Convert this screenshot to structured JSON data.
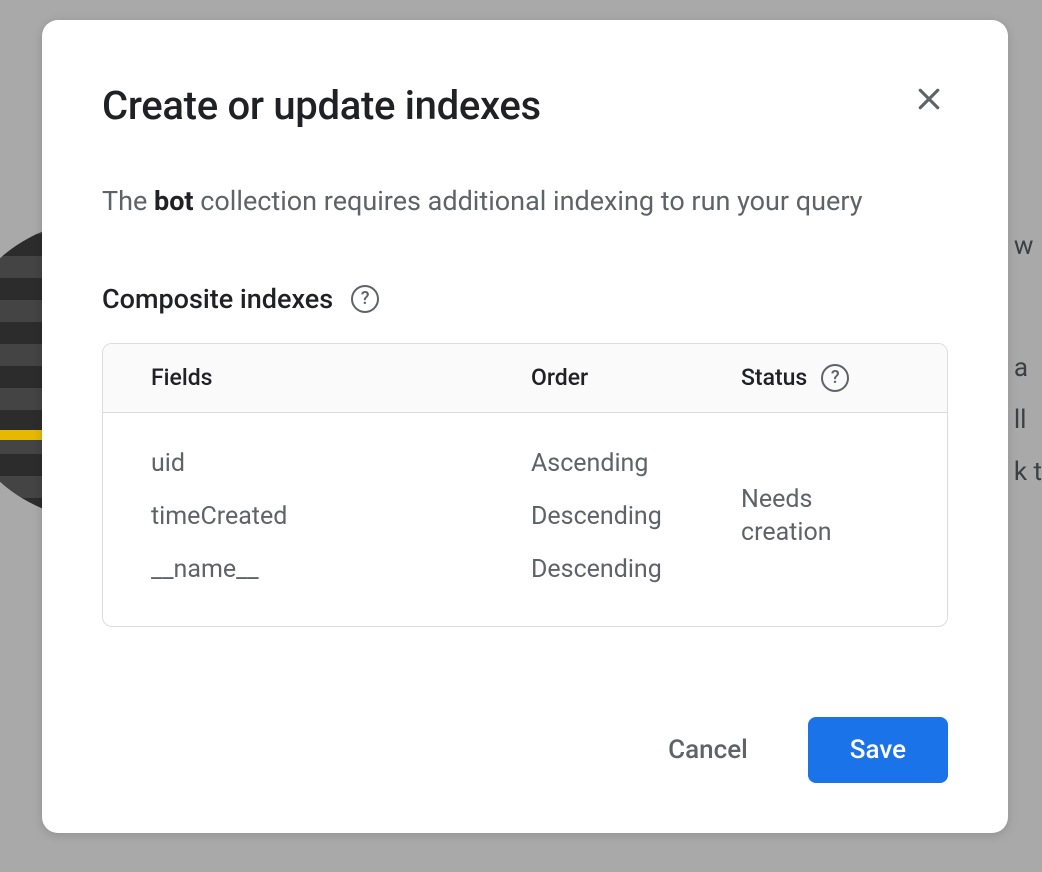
{
  "modal": {
    "title": "Create or update indexes",
    "description_prefix": "The ",
    "description_bold": "bot",
    "description_suffix": " collection requires additional indexing to run your query",
    "section_title": "Composite indexes",
    "table": {
      "headers": {
        "fields": "Fields",
        "order": "Order",
        "status": "Status"
      },
      "rows": [
        {
          "field": "uid",
          "order": "Ascending"
        },
        {
          "field": "timeCreated",
          "order": "Descending"
        },
        {
          "field": "__name__",
          "order": "Descending"
        }
      ],
      "status": "Needs creation"
    },
    "buttons": {
      "cancel": "Cancel",
      "save": "Save"
    }
  }
}
